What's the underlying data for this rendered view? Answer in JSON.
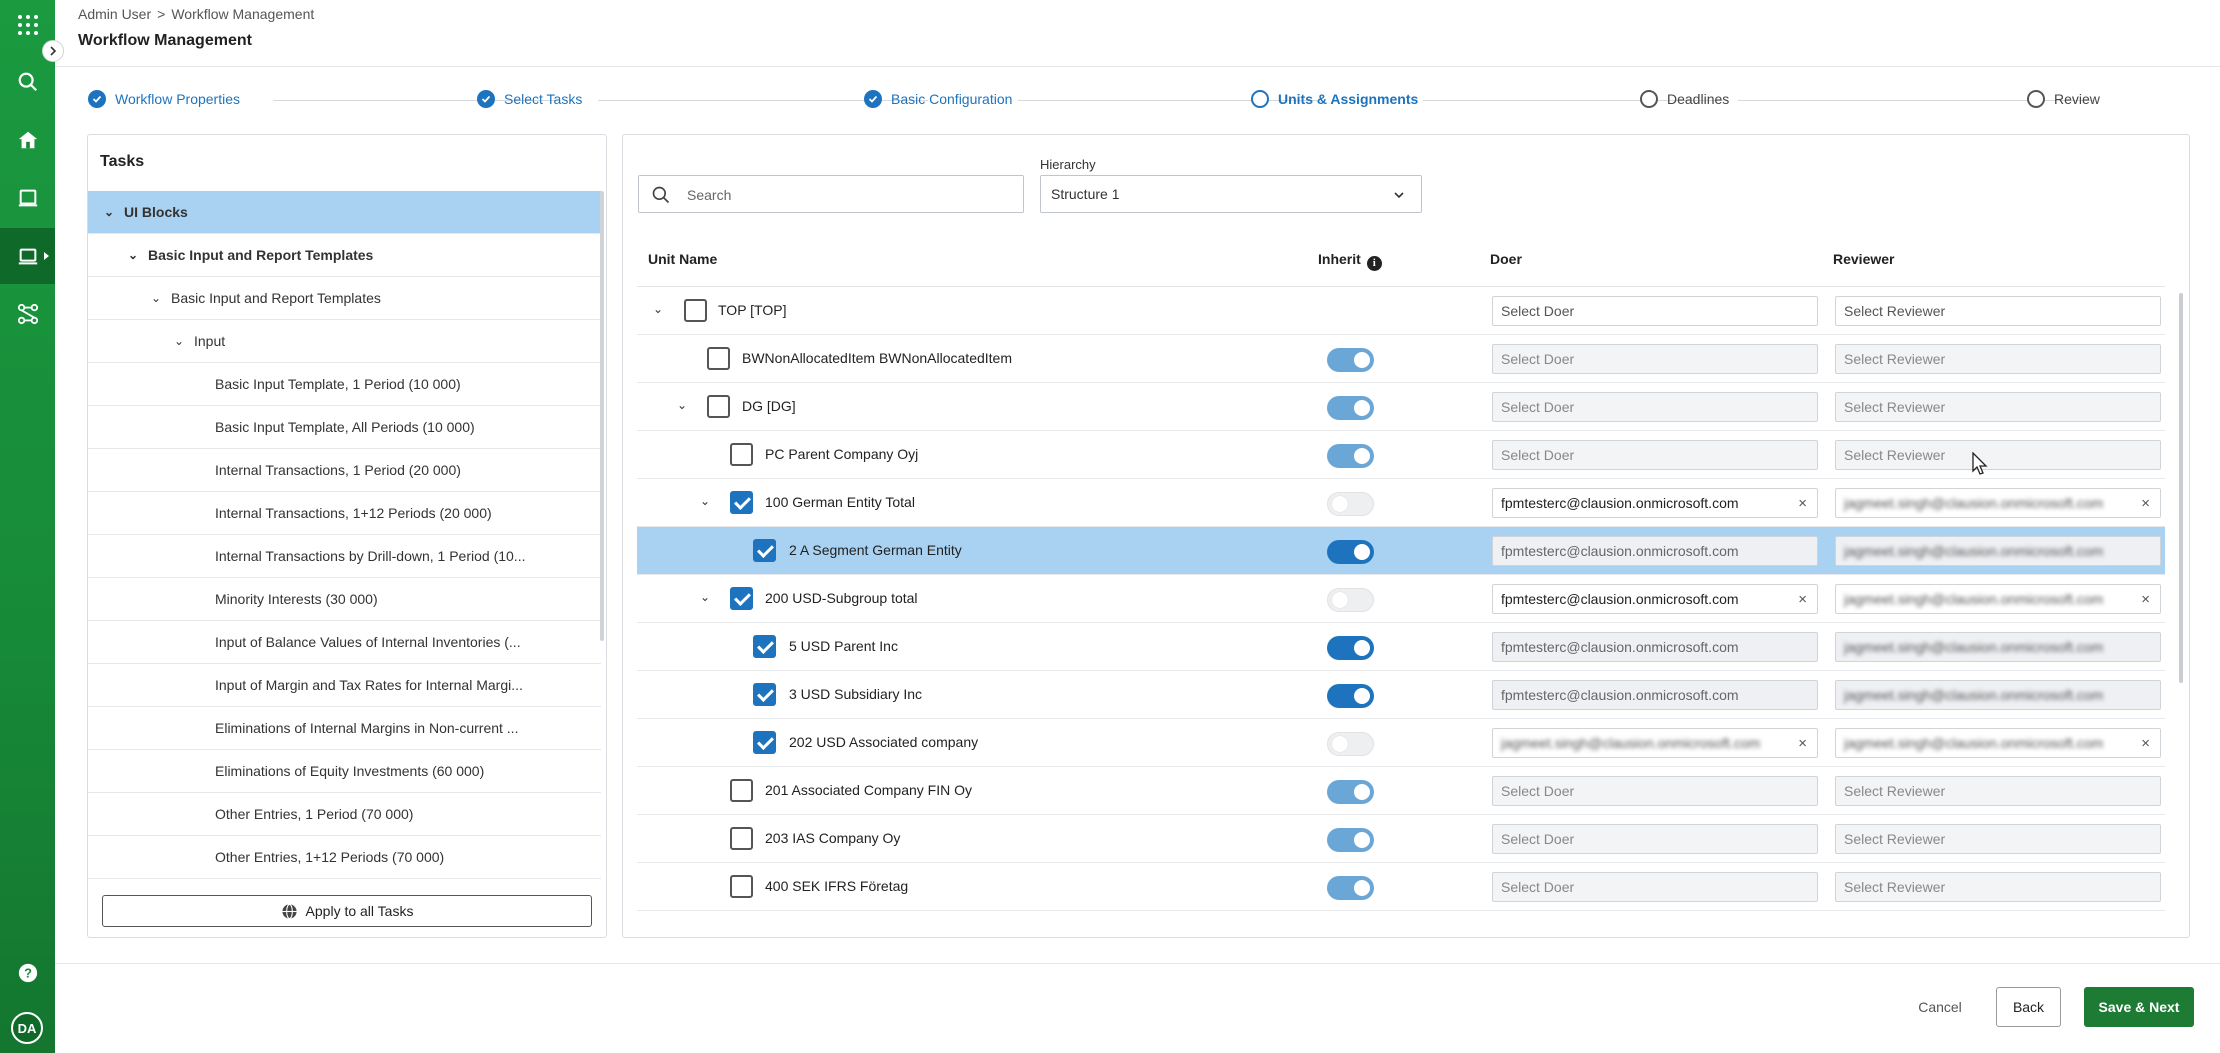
{
  "breadcrumb": {
    "root": "Admin User",
    "separator": ">",
    "current": "Workflow Management"
  },
  "page_title": "Workflow Management",
  "stepper": {
    "steps": [
      {
        "label": "Workflow Properties",
        "state": "done"
      },
      {
        "label": "Select Tasks",
        "state": "done"
      },
      {
        "label": "Basic Configuration",
        "state": "done"
      },
      {
        "label": "Units & Assignments",
        "state": "active"
      },
      {
        "label": "Deadlines",
        "state": "todo"
      },
      {
        "label": "Review",
        "state": "todo"
      }
    ]
  },
  "tasks": {
    "title": "Tasks",
    "items": [
      {
        "label": "UI Blocks",
        "chevron": "v"
      },
      {
        "label": "Basic Input and Report Templates",
        "chevron": "v"
      },
      {
        "label": "Basic Input and Report Templates",
        "chevron": "v"
      },
      {
        "label": "Input",
        "chevron": "v"
      },
      {
        "label": "Basic Input Template, 1 Period (10 000)"
      },
      {
        "label": "Basic Input Template, All Periods (10 000)"
      },
      {
        "label": "Internal Transactions, 1 Period (20 000)"
      },
      {
        "label": "Internal Transactions, 1+12 Periods (20 000)"
      },
      {
        "label": "Internal Transactions by Drill-down, 1 Period (10..."
      },
      {
        "label": "Minority Interests (30 000)"
      },
      {
        "label": "Input of Balance Values of Internal Inventories (..."
      },
      {
        "label": "Input of Margin and Tax Rates for Internal Margi..."
      },
      {
        "label": "Eliminations of Internal Margins in Non-current ..."
      },
      {
        "label": "Eliminations of Equity Investments (60 000)"
      },
      {
        "label": "Other Entries, 1 Period (70 000)"
      },
      {
        "label": "Other Entries, 1+12 Periods (70 000)"
      }
    ],
    "apply_button": "Apply to all Tasks"
  },
  "filters": {
    "search_placeholder": "Search",
    "hierarchy_label": "Hierarchy",
    "hierarchy_value": "Structure 1"
  },
  "grid": {
    "columns": {
      "unit_name": "Unit Name",
      "inherit": "Inherit",
      "doer": "Doer",
      "reviewer": "Reviewer"
    },
    "rows": [
      {
        "name": "TOP [TOP]",
        "checked": false,
        "inherit": "none",
        "doer": "Select Doer",
        "reviewer": "Select Reviewer",
        "doer_state": "editable",
        "reviewer_state": "editable",
        "chevron": true
      },
      {
        "name": "BWNonAllocatedItem BWNonAllocatedItem",
        "checked": false,
        "inherit": "on-dim",
        "doer": "Select Doer",
        "reviewer": "Select Reviewer",
        "doer_state": "disabled",
        "reviewer_state": "disabled"
      },
      {
        "name": "DG [DG]",
        "checked": false,
        "inherit": "on-dim",
        "doer": "Select Doer",
        "reviewer": "Select Reviewer",
        "doer_state": "disabled",
        "reviewer_state": "disabled",
        "chevron": true
      },
      {
        "name": "PC Parent Company Oyj",
        "checked": false,
        "inherit": "on-dim",
        "doer": "Select Doer",
        "reviewer": "Select Reviewer",
        "doer_state": "disabled",
        "reviewer_state": "disabled"
      },
      {
        "name": "100 German Entity Total",
        "checked": true,
        "inherit": "off",
        "doer": "fpmtesterc@clausion.onmicrosoft.com",
        "reviewer": "jagmeet.singh@clausion.onmicrosoft.com",
        "doer_state": "value",
        "reviewer_state": "value-blur",
        "chevron": true
      },
      {
        "name": "2 A Segment German Entity",
        "checked": true,
        "inherit": "on",
        "doer": "fpmtesterc@clausion.onmicrosoft.com",
        "reviewer": "jagmeet.singh@clausion.onmicrosoft.com",
        "doer_state": "ro",
        "reviewer_state": "ro-blur",
        "highlight": true
      },
      {
        "name": "200 USD-Subgroup total",
        "checked": true,
        "inherit": "off",
        "doer": "fpmtesterc@clausion.onmicrosoft.com",
        "reviewer": "jagmeet.singh@clausion.onmicrosoft.com",
        "doer_state": "value",
        "reviewer_state": "value-blur",
        "chevron": true
      },
      {
        "name": "5 USD Parent Inc",
        "checked": true,
        "inherit": "on",
        "doer": "fpmtesterc@clausion.onmicrosoft.com",
        "reviewer": "jagmeet.singh@clausion.onmicrosoft.com",
        "doer_state": "ro",
        "reviewer_state": "ro-blur"
      },
      {
        "name": "3 USD Subsidiary Inc",
        "checked": true,
        "inherit": "on",
        "doer": "fpmtesterc@clausion.onmicrosoft.com",
        "reviewer": "jagmeet.singh@clausion.onmicrosoft.com",
        "doer_state": "ro",
        "reviewer_state": "ro-blur"
      },
      {
        "name": "202 USD Associated company",
        "checked": true,
        "inherit": "off",
        "doer": "jagmeet.singh@clausion.onmicrosoft.com",
        "reviewer": "jagmeet.singh@clausion.onmicrosoft.com",
        "doer_state": "value-blur",
        "reviewer_state": "value-blur"
      },
      {
        "name": "201 Associated Company FIN Oy",
        "checked": false,
        "inherit": "on-dim",
        "doer": "Select Doer",
        "reviewer": "Select Reviewer",
        "doer_state": "disabled",
        "reviewer_state": "disabled"
      },
      {
        "name": "203 IAS Company Oy",
        "checked": false,
        "inherit": "on-dim",
        "doer": "Select Doer",
        "reviewer": "Select Reviewer",
        "doer_state": "disabled",
        "reviewer_state": "disabled"
      },
      {
        "name": "400 SEK IFRS Företag",
        "checked": false,
        "inherit": "on-dim",
        "doer": "Select Doer",
        "reviewer": "Select Reviewer",
        "doer_state": "disabled",
        "reviewer_state": "disabled"
      }
    ]
  },
  "footer": {
    "cancel": "Cancel",
    "back": "Back",
    "save_next": "Save & Next"
  },
  "user": {
    "initials": "DA"
  },
  "colors": {
    "accent": "#1e73be",
    "brand_green": "#178a38",
    "highlight_row": "#a9d1f1",
    "save_button": "#1e7b34"
  },
  "icons": [
    "apps-grid-icon",
    "search-icon",
    "home-icon",
    "book-icon",
    "laptop-icon",
    "workflow-icon",
    "help-icon",
    "globe-icon",
    "info-icon",
    "chevron-down-icon",
    "clear-icon"
  ]
}
